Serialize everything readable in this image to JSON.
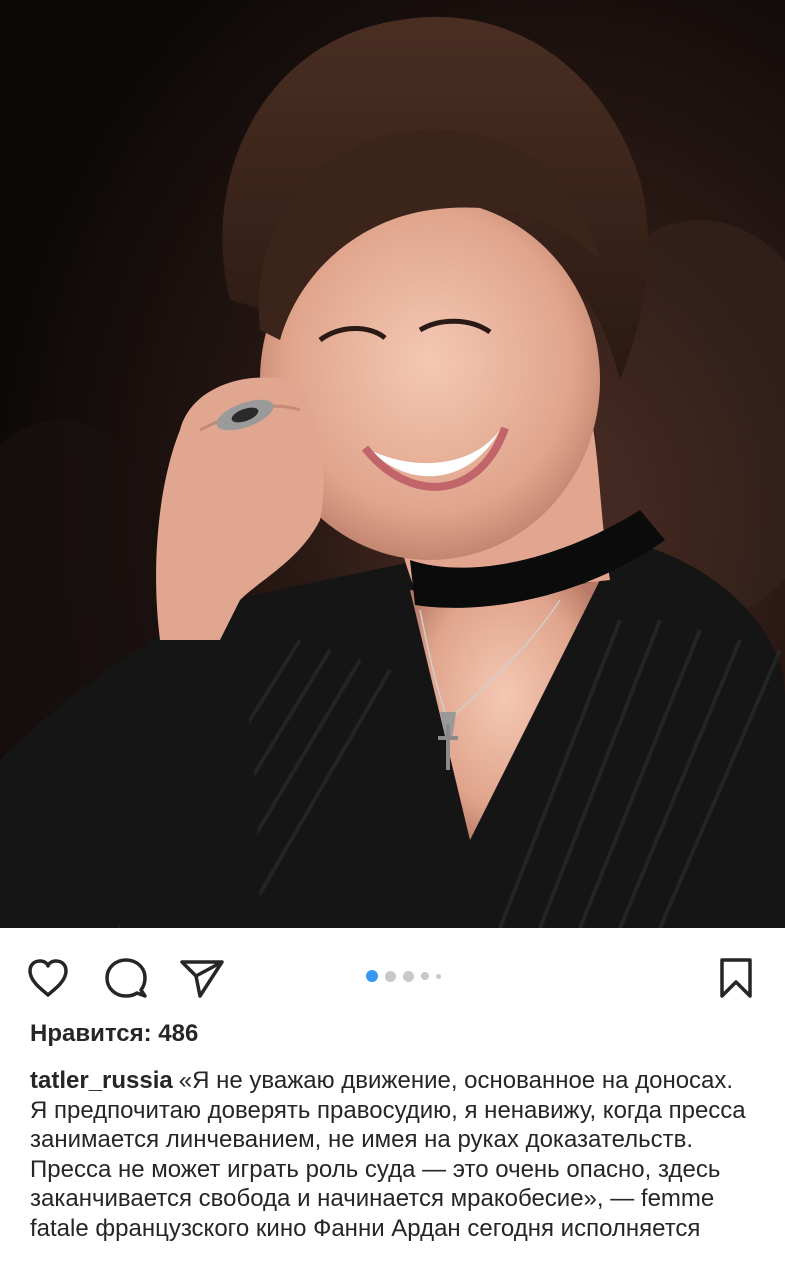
{
  "post": {
    "image": {
      "description_icon": "photo-image",
      "carousel": {
        "total": 5,
        "active_index": 0,
        "active_color": "#3897f0",
        "inactive_color": "#c8c8c8"
      }
    },
    "actions": {
      "like_icon": "heart-icon",
      "comment_icon": "comment-icon",
      "share_icon": "paper-plane-icon",
      "save_icon": "bookmark-icon"
    },
    "likes_text": "Нравится: 486",
    "caption": {
      "username": "tatler_russia",
      "text": "«Я не уважаю движение, основанное на доносах. Я предпочитаю доверять правосудию, я ненавижу, когда пресса занимается линчеванием, не имея на руках доказательств. Пресса не может играть роль суда — это очень опасно, здесь заканчивается свобода и начинается мракобесие», — femme fatale французского кино Фанни Ардан сегодня исполняется"
    }
  }
}
